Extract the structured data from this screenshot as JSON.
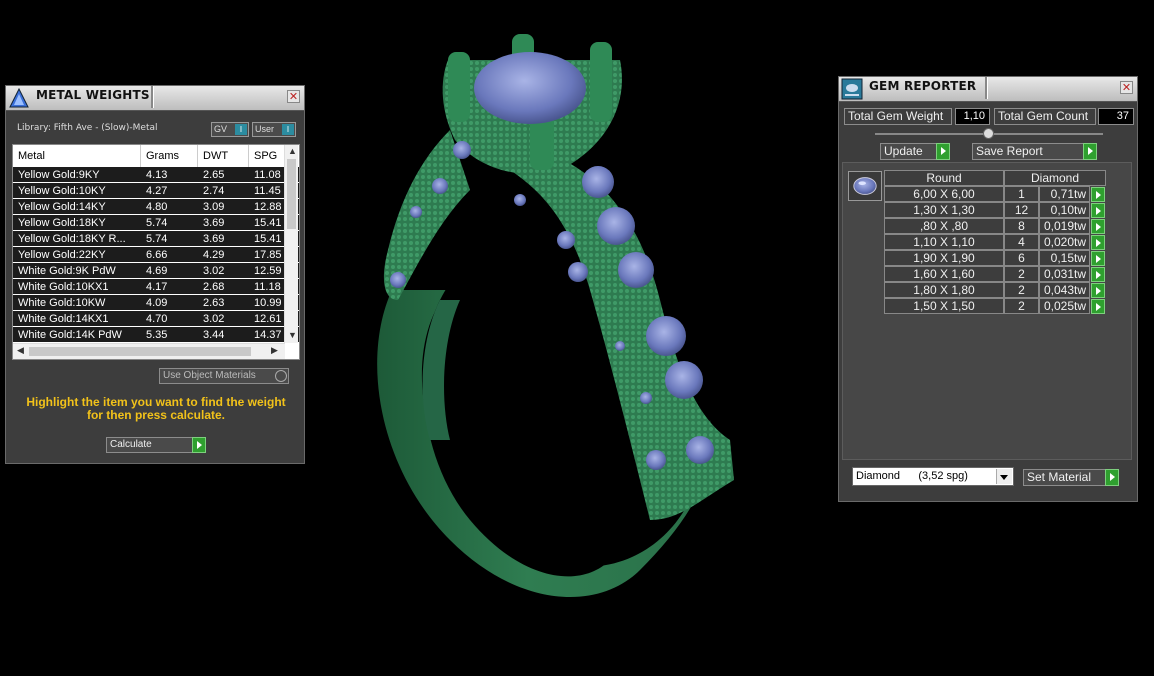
{
  "metal_panel": {
    "title": "METAL WEIGHTS",
    "library_label": "Library: Fifth Ave - (Slow)-Metal",
    "gv_label": "GV",
    "user_label": "User",
    "indicator": "I",
    "columns": [
      "Metal",
      "Grams",
      "DWT",
      "SPG"
    ],
    "rows": [
      [
        "Yellow Gold:9KY",
        "4.13",
        "2.65",
        "11.08"
      ],
      [
        "Yellow Gold:10KY",
        "4.27",
        "2.74",
        "11.45"
      ],
      [
        "Yellow Gold:14KY",
        "4.80",
        "3.09",
        "12.88"
      ],
      [
        "Yellow Gold:18KY",
        "5.74",
        "3.69",
        "15.41"
      ],
      [
        "Yellow Gold:18KY R...",
        "5.74",
        "3.69",
        "15.41"
      ],
      [
        "Yellow Gold:22KY",
        "6.66",
        "4.29",
        "17.85"
      ],
      [
        "White Gold:9K PdW",
        "4.69",
        "3.02",
        "12.59"
      ],
      [
        "White Gold:10KX1",
        "4.17",
        "2.68",
        "11.18"
      ],
      [
        "White Gold:10KW",
        "4.09",
        "2.63",
        "10.99"
      ],
      [
        "White Gold:14KX1",
        "4.70",
        "3.02",
        "12.61"
      ],
      [
        "White Gold:14K PdW",
        "5.35",
        "3.44",
        "14.37"
      ]
    ],
    "use_object_materials": "Use Object Materials",
    "hint": "Highlight the item you want to find the weight for then press calculate.",
    "calculate_label": "Calculate"
  },
  "gem_panel": {
    "title": "GEM REPORTER",
    "total_weight_label": "Total Gem Weight",
    "total_weight_value": "1,10",
    "total_count_label": "Total Gem Count",
    "total_count_value": "37",
    "update_label": "Update",
    "save_report_label": "Save Report",
    "shape_header": "Round",
    "material_header": "Diamond",
    "rows": [
      [
        "6,00 X 6,00",
        "1",
        "0,71tw"
      ],
      [
        "1,30 X 1,30",
        "12",
        "0,10tw"
      ],
      [
        ",80 X ,80",
        "8",
        "0,019tw"
      ],
      [
        "1,10 X 1,10",
        "4",
        "0,020tw"
      ],
      [
        "1,90 X 1,90",
        "6",
        "0,15tw"
      ],
      [
        "1,60 X 1,60",
        "2",
        "0,031tw"
      ],
      [
        "1,80 X 1,80",
        "2",
        "0,043tw"
      ],
      [
        "1,50 X 1,50",
        "2",
        "0,025tw"
      ]
    ],
    "material_select": "Diamond      (3,52 spg)",
    "set_material_label": "Set Material"
  },
  "colors": {
    "ring_green": "#2f7a50",
    "gem_blue": "#7080c0",
    "hint_yellow": "#f2c21a",
    "go_green": "#2fa02f"
  }
}
